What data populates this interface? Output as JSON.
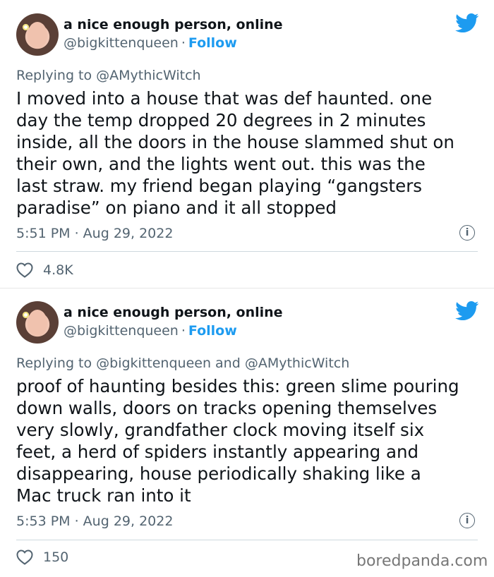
{
  "tweets": [
    {
      "author_name": "a nice enough person, online",
      "handle": "@bigkittenqueen",
      "separator": "·",
      "follow_label": "Follow",
      "replying_to": "Replying to @AMythicWitch",
      "text_lines": [
        "I moved into a house that was def haunted. one",
        "day the temp dropped 20 degrees in 2 minutes",
        "inside, all the doors in the house slammed shut on",
        "their own, and the lights went out. this was the",
        "last straw. my friend began playing “gangsters",
        "paradise” on piano and it all stopped"
      ],
      "timestamp": "5:51 PM · Aug 29, 2022",
      "likes": "4.8K"
    },
    {
      "author_name": "a nice enough person, online",
      "handle": "@bigkittenqueen",
      "separator": "·",
      "follow_label": "Follow",
      "replying_to": "Replying to @bigkittenqueen and @AMythicWitch",
      "text_lines": [
        "proof of haunting besides this: green slime pouring",
        "down walls, doors on tracks opening themselves",
        "very slowly, grandfather clock moving itself six",
        "feet, a herd of spiders instantly appearing and",
        "disappearing, house periodically shaking like a",
        "Mac truck ran into it"
      ],
      "timestamp": "5:53 PM · Aug 29, 2022",
      "likes": "150"
    }
  ],
  "info_glyph": "i",
  "watermark": "boredpanda.com",
  "colors": {
    "twitter_blue": "#1d9bf0",
    "text": "#0f1419",
    "secondary": "#536471"
  },
  "icons": [
    "twitter-bird-icon",
    "info-icon",
    "heart-icon"
  ]
}
